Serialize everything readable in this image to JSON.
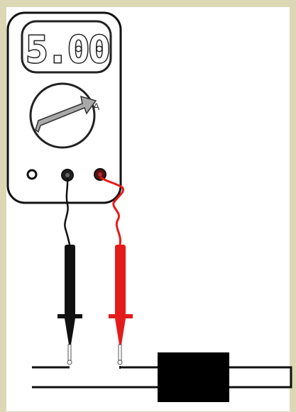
{
  "multimeter": {
    "reading": "5.00",
    "dial_label": "A",
    "jacks": [
      "left-jack",
      "com-jack",
      "red-jack"
    ]
  },
  "colors": {
    "background": "#dcd8b6",
    "panel": "#ffffff",
    "black_lead": "#111111",
    "red_lead": "#e41b1b",
    "dial_arrow": "#a9a9a9",
    "component": "#000000"
  },
  "icons": {
    "meter": "multimeter-icon",
    "dial": "dial-icon",
    "arrow": "selector-arrow-icon",
    "black_probe": "black-probe-icon",
    "red_probe": "red-probe-icon",
    "resistor": "component-icon"
  }
}
